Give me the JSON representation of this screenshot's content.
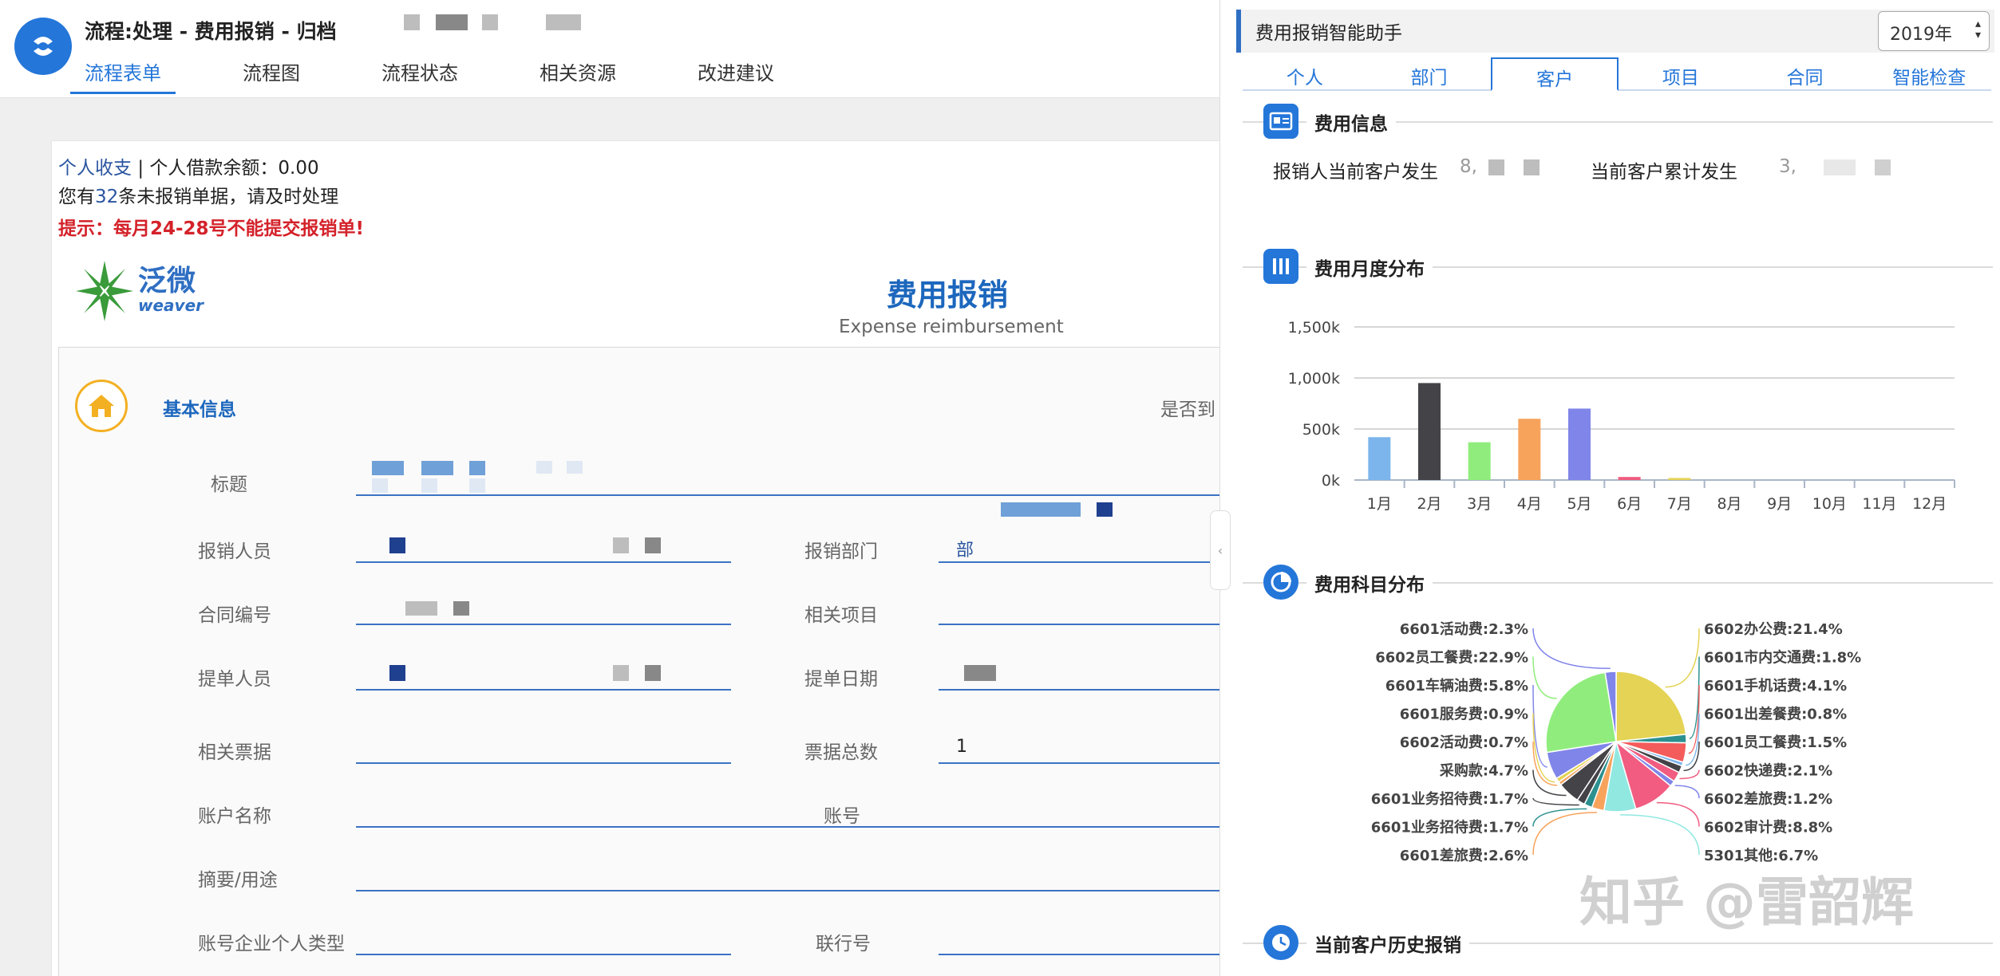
{
  "header": {
    "title": "流程:处理 - 费用报销 - 归档",
    "tabs": [
      "流程表单",
      "流程图",
      "流程状态",
      "相关资源",
      "改进建议"
    ],
    "active_tab": 0
  },
  "info": {
    "personal_link": "个人收支",
    "loan_balance": "| 个人借款余额：0.00",
    "pending_prefix": "您有",
    "pending_count": "32",
    "pending_suffix": "条未报销单据，请及时处理",
    "warning": "提示：每月24-28号不能提交报销单!"
  },
  "brand": {
    "cn": "泛微",
    "en": "weaver"
  },
  "form": {
    "title": "费用报销",
    "subtitle": "Expense reimbursement",
    "section": "基本信息",
    "flag_label": "是否到",
    "labels": {
      "title": "标题",
      "reporter": "报销人员",
      "dept": "报销部门",
      "contract": "合同编号",
      "project": "相关项目",
      "submitter": "提单人员",
      "submit_date": "提单日期",
      "receipts": "相关票据",
      "receipt_count": "票据总数",
      "account_name": "账户名称",
      "account_no": "账号",
      "summary": "摘要/用途",
      "account_type": "账号企业个人类型",
      "bank_no": "联行号"
    },
    "values": {
      "dept": "部",
      "receipt_count": "1"
    }
  },
  "assistant": {
    "title": "费用报销智能助手",
    "year": "2019年",
    "tabs": [
      "个人",
      "部门",
      "客户",
      "项目",
      "合同",
      "智能检查"
    ],
    "active_tab": 2,
    "sections": {
      "info": "费用信息",
      "monthly": "费用月度分布",
      "category": "费用科目分布",
      "history": "当前客户历史报销"
    },
    "stats": {
      "reporter_label": "报销人当前客户发生",
      "reporter_value": "8,",
      "total_label": "当前客户累计发生",
      "total_value": "3,"
    },
    "watermark": "知乎 @雷韶辉"
  },
  "chart_data": [
    {
      "type": "bar",
      "categories": [
        "1月",
        "2月",
        "3月",
        "4月",
        "5月",
        "6月",
        "7月",
        "8月",
        "9月",
        "10月",
        "11月",
        "12月"
      ],
      "values": [
        420000,
        950000,
        370000,
        600000,
        700000,
        30000,
        20000,
        0,
        0,
        0,
        0,
        0
      ],
      "colors": [
        "#7cb5ec",
        "#434348",
        "#90ed7d",
        "#f7a35c",
        "#8085e9",
        "#f15c80",
        "#e4d354",
        "#2b908f",
        "#f45b5b",
        "#91e8e1",
        "#7cb5ec",
        "#434348"
      ],
      "ytick_labels": [
        "0k",
        "500k",
        "1,000k",
        "1,500k"
      ],
      "ylim": [
        0,
        1500000
      ],
      "grid": true
    },
    {
      "type": "pie",
      "slices": [
        {
          "label": "6602办公费",
          "value": 21.4,
          "color": "#e4d354"
        },
        {
          "label": "6601市内交通费",
          "value": 1.8,
          "color": "#2b908f"
        },
        {
          "label": "6601手机话费",
          "value": 4.1,
          "color": "#f45b5b"
        },
        {
          "label": "6601出差餐费",
          "value": 0.8,
          "color": "#7cb5ec"
        },
        {
          "label": "6601员工餐费",
          "value": 1.5,
          "color": "#434348"
        },
        {
          "label": "6602快递费",
          "value": 2.1,
          "color": "#f15c80"
        },
        {
          "label": "6602差旅费",
          "value": 1.2,
          "color": "#8085e9"
        },
        {
          "label": "6602审计费",
          "value": 8.8,
          "color": "#f15c80"
        },
        {
          "label": "5301其他",
          "value": 6.7,
          "color": "#91e8e1"
        },
        {
          "label": "6601差旅费",
          "value": 2.6,
          "color": "#f7a35c"
        },
        {
          "label": "6601业务招待费",
          "value": 1.7,
          "color": "#2b908f"
        },
        {
          "label": "6601业务招待费",
          "value": 1.7,
          "color": "#434348"
        },
        {
          "label": "采购款",
          "value": 4.7,
          "color": "#434348"
        },
        {
          "label": "6602活动费",
          "value": 0.7,
          "color": "#f7a35c"
        },
        {
          "label": "6601服务费",
          "value": 0.9,
          "color": "#e4d354"
        },
        {
          "label": "6601车辆油费",
          "value": 5.8,
          "color": "#8085e9"
        },
        {
          "label": "6602员工餐费",
          "value": 22.9,
          "color": "#90ed7d"
        },
        {
          "label": "6601活动费",
          "value": 2.3,
          "color": "#8085e9"
        }
      ],
      "value_format": "percent"
    }
  ]
}
